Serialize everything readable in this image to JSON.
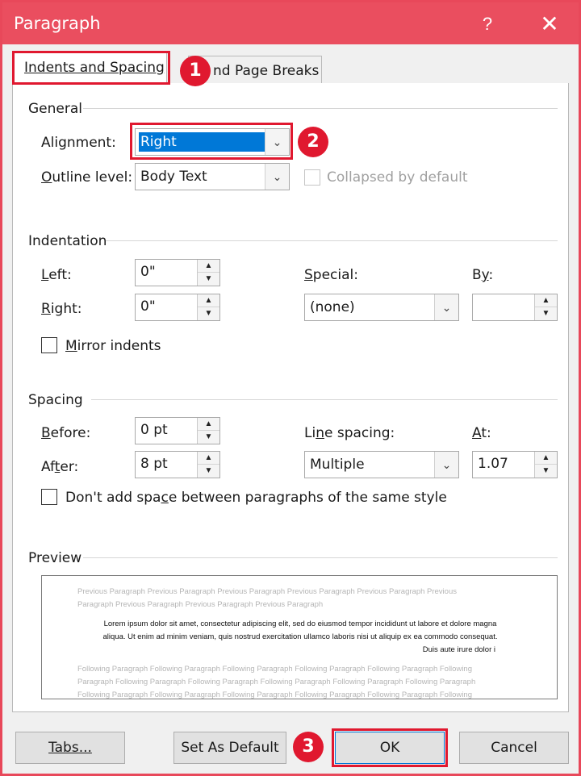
{
  "window": {
    "title": "Paragraph",
    "help_label": "?",
    "close_label": "✕"
  },
  "tabs": [
    {
      "label": "Indents and Spacing"
    },
    {
      "label": "nd Page Breaks"
    }
  ],
  "callouts": [
    "1",
    "2",
    "3"
  ],
  "general": {
    "heading": "General",
    "alignment_label": "Alignment:",
    "alignment_value": "Right",
    "outline_label": "Outline level:",
    "outline_value": "Body Text",
    "collapsed_label": "Collapsed by default"
  },
  "indentation": {
    "heading": "Indentation",
    "left_label": "Left:",
    "left_value": "0\"",
    "right_label": "Right:",
    "right_value": "0\"",
    "special_label": "Special:",
    "special_value": "(none)",
    "by_label": "By:",
    "by_value": "",
    "mirror_label": "Mirror indents"
  },
  "spacing": {
    "heading": "Spacing",
    "before_label": "Before:",
    "before_value": "0 pt",
    "after_label": "After:",
    "after_value": "8 pt",
    "line_spacing_label": "Line spacing:",
    "line_spacing_value": "Multiple",
    "at_label": "At:",
    "at_value": "1.07",
    "dont_add_label": "Don't add space between paragraphs of the same style"
  },
  "preview": {
    "heading": "Preview",
    "prev_lines": [
      "Previous Paragraph Previous Paragraph Previous Paragraph Previous Paragraph Previous Paragraph Previous",
      "Paragraph Previous Paragraph Previous Paragraph Previous Paragraph"
    ],
    "sample_lines": [
      "Lorem ipsum dolor sit amet, consectetur adipiscing elit, sed do eiusmod tempor incididunt ut labore et dolore magna",
      "aliqua. Ut enim ad minim veniam, quis nostrud exercitation ullamco laboris nisi ut aliquip ex ea commodo consequat.",
      "Duis aute irure dolor i"
    ],
    "follow_lines": [
      "Following Paragraph Following Paragraph Following Paragraph Following Paragraph Following Paragraph Following",
      "Paragraph Following Paragraph Following Paragraph Following Paragraph Following Paragraph Following Paragraph",
      "Following Paragraph Following Paragraph Following Paragraph Following Paragraph Following Paragraph Following"
    ]
  },
  "buttons": {
    "tabs": "Tabs...",
    "set_default": "Set As Default",
    "ok": "OK",
    "cancel": "Cancel"
  },
  "colors": {
    "titlebar": "#ea4e5f",
    "highlight": "#e0182f",
    "selection": "#0078d7"
  }
}
